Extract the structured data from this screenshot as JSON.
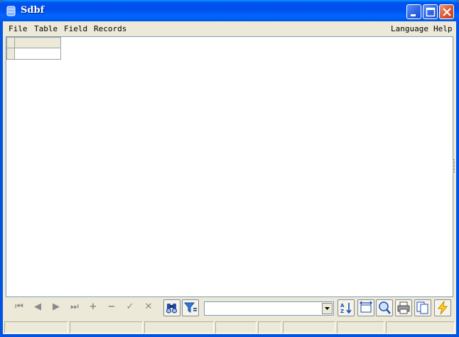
{
  "window": {
    "title": "Sdbf",
    "title_icon": "database-icon",
    "controls": [
      "minimize-icon",
      "maximize-icon",
      "close-icon"
    ]
  },
  "menu": {
    "left": [
      "File",
      "Table",
      "Field",
      "Records"
    ],
    "right": [
      "Language",
      "Help"
    ]
  },
  "grid": {
    "columns": [
      ""
    ],
    "rows": [
      [
        ""
      ]
    ]
  },
  "navigator": {
    "buttons": [
      "first-record-icon",
      "prior-record-icon",
      "next-record-icon",
      "last-record-icon",
      "add-record-icon",
      "delete-record-icon",
      "post-icon",
      "cancel-icon"
    ],
    "glyphs": [
      "⏮",
      "◀",
      "▶",
      "⏭",
      "+",
      "−",
      "✓",
      "✕"
    ]
  },
  "toolbar": {
    "tools": [
      "find-icon",
      "filter-icon",
      "sort-icon",
      "fit-columns-icon",
      "zoom-icon",
      "print-icon",
      "copy-icon",
      "execute-icon"
    ],
    "filter_value": ""
  },
  "status": {
    "panels": [
      "",
      "",
      "",
      "",
      "",
      "",
      "",
      ""
    ]
  },
  "colors": {
    "titlebar": "#0054e3",
    "frame": "#ece9d8",
    "close_button": "#d8542f"
  }
}
